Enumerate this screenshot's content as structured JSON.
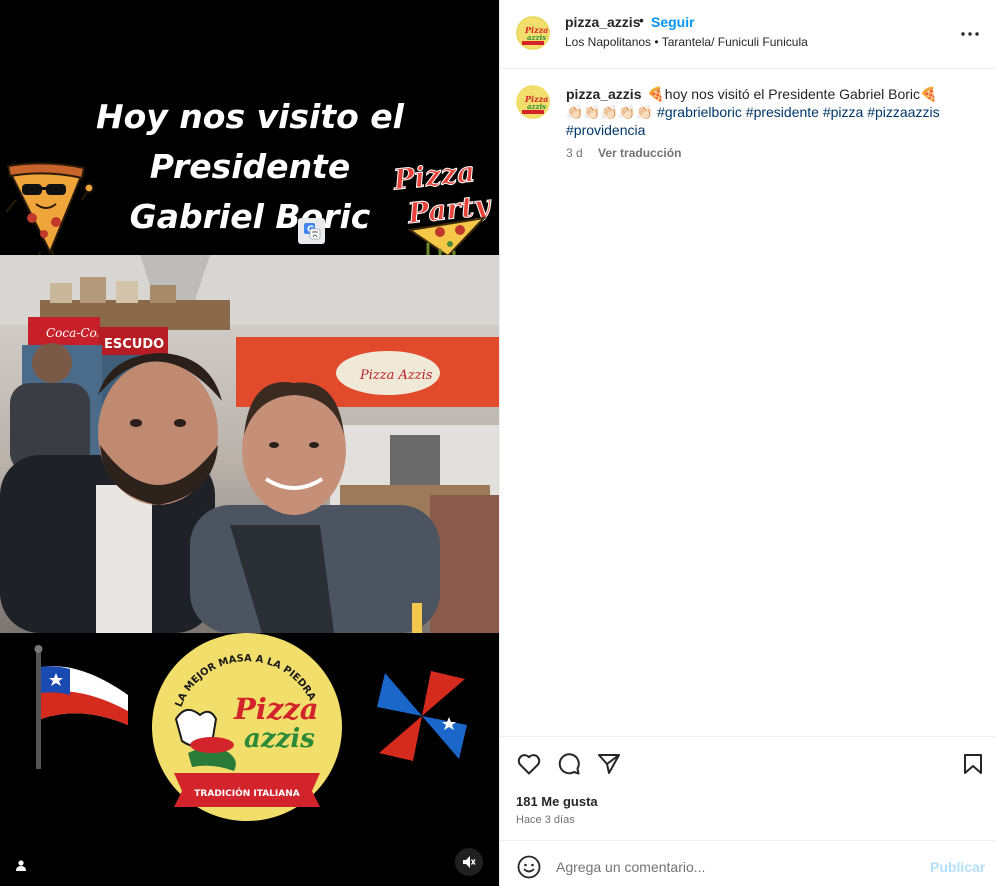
{
  "media": {
    "title_lines": [
      "Hoy nos visito el",
      "Presidente",
      "Gabriel Boric"
    ],
    "sticker_party_text": [
      "Pizza",
      "Party"
    ],
    "logo": {
      "top_arc": "LA MEJOR MASA A LA PIEDRA",
      "brand_1": "Pizza",
      "brand_2": "azzis",
      "ribbon": "TRADICIÓN ITALIANA"
    },
    "photo_signs": {
      "coca": "Coca-Cola",
      "escudo": "ESCUDO",
      "pizza_sign": "Pizza Azzis"
    },
    "colors": {
      "logo_yellow": "#f2df6b",
      "logo_red": "#d4242b",
      "chile_blue": "#1a4bb2",
      "chile_red": "#d52b1e"
    }
  },
  "header": {
    "username": "pizza_azzis",
    "dot": "•",
    "follow_label": "Seguir",
    "location": "Los Napolitanos • Tarantela/ Funiculi Funicula",
    "more_icon": "more-horizontal-icon"
  },
  "caption": {
    "username": "pizza_azzis",
    "text": "🍕hoy nos visitó el Presidente Gabriel Boric🍕",
    "claps": "👏🏻👏🏻👏🏻👏🏻👏🏻",
    "hashtags": [
      "#grabrielboric",
      "#presidente",
      "#pizza",
      "#pizzaazzis",
      "#providencia"
    ],
    "time": "3 d",
    "translate_label": "Ver traducción"
  },
  "actions": {
    "likes": "181 Me gusta",
    "time_ago": "Hace 3 días"
  },
  "comment_box": {
    "placeholder": "Agrega un comentario...",
    "publish_label": "Publicar"
  },
  "accent": "#0095f6"
}
